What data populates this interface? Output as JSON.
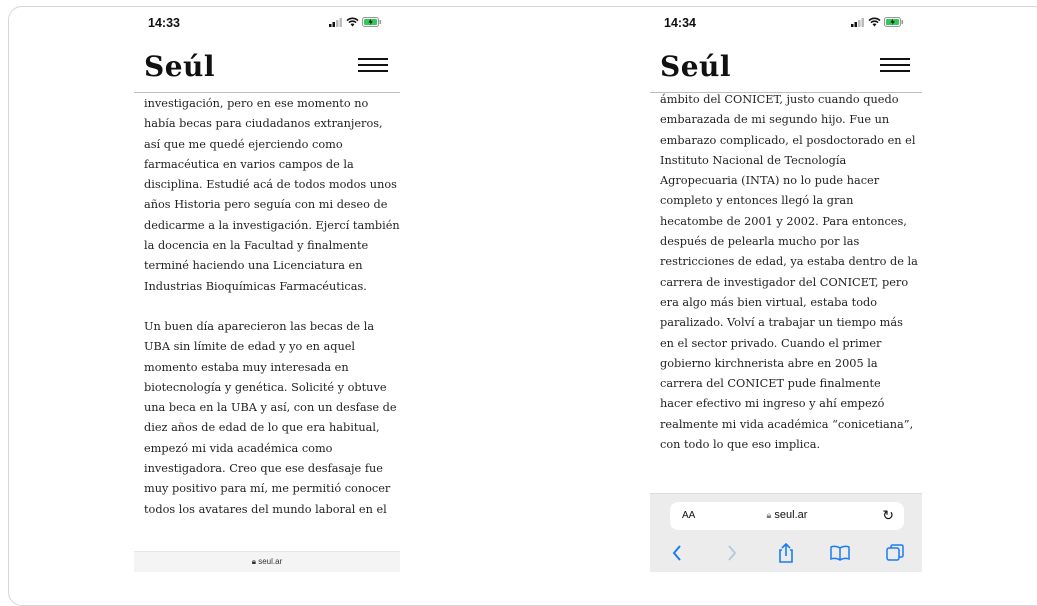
{
  "left_phone": {
    "time": "14:33",
    "logo": "Seúl",
    "paragraph1_lines": [
      "investigación, pero en ese momento no",
      "había becas para ciudadanos extranjeros,",
      "así que me quedé ejerciendo como",
      "farmacéutica en varios campos de la",
      "disciplina. Estudié acá de todos modos unos",
      "años Historia pero seguía con mi deseo de",
      "dedicarme a la investigación. Ejercí también",
      "la docencia en la Facultad y finalmente",
      "terminé haciendo una Licenciatura en",
      "Industrias Bioquímicas Farmacéuticas."
    ],
    "paragraph2_lines": [
      "Un buen día aparecieron las becas de la",
      "UBA sin límite de edad y yo en aquel",
      "momento estaba muy interesada en",
      "biotecnología y genética. Solicité y obtuve",
      "una beca en la UBA y así, con un desfase de",
      "diez años de edad de lo que era habitual,",
      "empezó mi vida académica como",
      "investigadora. Creo que ese desfasaje fue",
      "muy positivo para mí, me permitió conocer",
      "todos los avatares del mundo laboral en el"
    ],
    "footer_url": "seul.ar"
  },
  "right_phone": {
    "time": "14:34",
    "logo": "Seúl",
    "paragraph_lines": [
      "ámbito del CONICET, justo cuando quedo",
      "embarazada de mi segundo hijo. Fue un",
      "embarazo complicado, el posdoctorado en el",
      "Instituto Nacional de Tecnología",
      "Agropecuaria (INTA) no lo pude hacer",
      "completo y entonces llegó la gran",
      "hecatombe de 2001 y 2002. Para entonces,",
      "después de pelearla mucho por las",
      "restricciones de edad, ya estaba dentro de la",
      "carrera de investigador del CONICET, pero",
      "era algo más bien virtual, estaba todo",
      "paralizado. Volví a trabajar un tiempo más",
      "en el sector privado. Cuando el primer",
      "gobierno kirchnerista abre en 2005 la",
      "carrera del CONICET pude finalmente",
      "hacer efectivo mi ingreso y ahí empezó",
      "realmente mi vida académica “conicetiana”,",
      "con todo lo que eso implica."
    ],
    "browser": {
      "aa_label": "AA",
      "url": "seul.ar",
      "reload_icon": "reload-icon",
      "toolbar_icons": [
        "back-icon",
        "forward-icon",
        "share-icon",
        "bookmarks-icon",
        "tabs-icon"
      ]
    }
  },
  "colors": {
    "text": "#222222",
    "battery": "#34c759",
    "browser_bar": "#ececec"
  }
}
